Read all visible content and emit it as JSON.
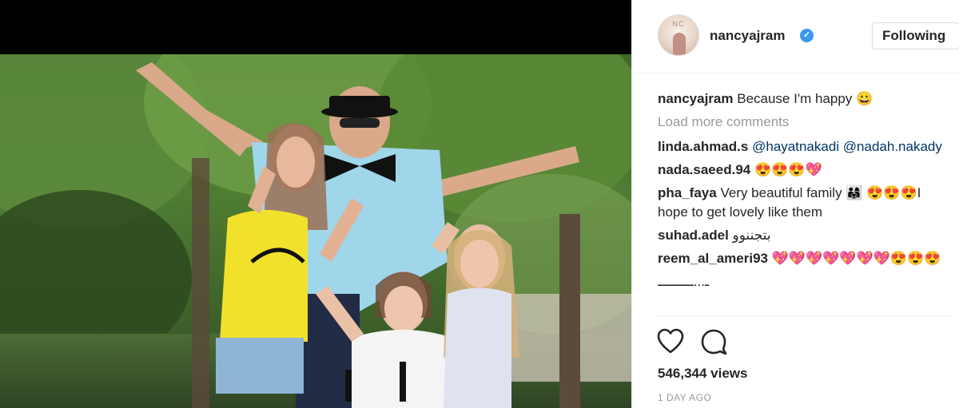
{
  "post": {
    "username": "nancyajram",
    "follow_button": "Following",
    "verified_icon": "verified-badge-icon",
    "caption": {
      "username": "nancyajram",
      "text": "Because I'm happy 😀"
    },
    "load_more": "Load more comments",
    "comments": [
      {
        "username": "linda.ahmad.s",
        "mentions": [
          "@hayatnakadi",
          "@nadah.nakady"
        ],
        "text": ""
      },
      {
        "username": "nada.saeed.94",
        "text": "😍😍😍💖"
      },
      {
        "username": "pha_faya",
        "text": "Very beautiful family 👨‍👩‍👧 😍😍😍I hope to get lovely like them"
      },
      {
        "username": "suhad.adel",
        "text": "بتجننوو"
      },
      {
        "username": "reem_al_ameri93",
        "text": "💖💖💖💖💖💖💖😍😍😍"
      },
      {
        "username": "",
        "text": "ـ...ـــــــــ"
      }
    ],
    "views": "546,344 views",
    "time": "1 DAY AGO",
    "actions": {
      "like_icon": "heart-icon",
      "comment_icon": "comment-bubble-icon"
    },
    "colors": {
      "verified": "#3897f0",
      "mention": "#003569",
      "muted": "#999999"
    }
  }
}
